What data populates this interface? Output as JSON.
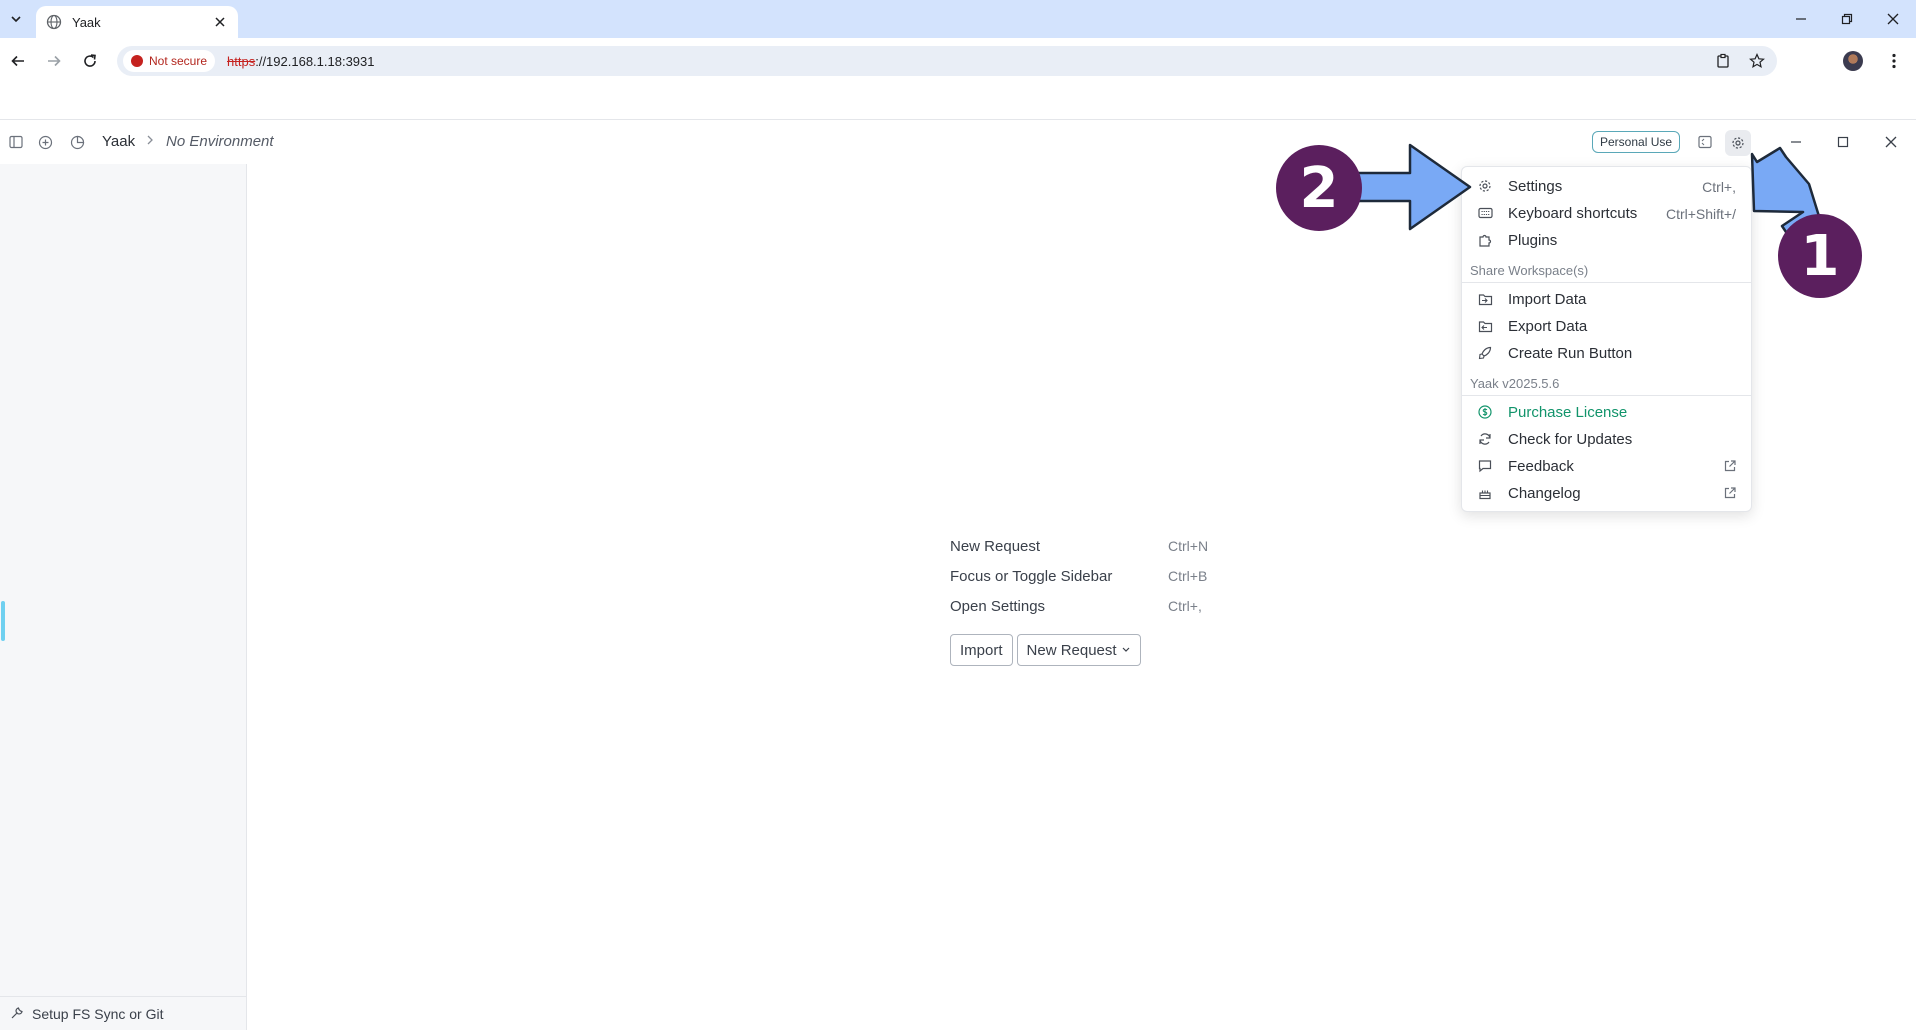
{
  "browser": {
    "tab_title": "Yaak",
    "security_label": "Not secure",
    "url_scheme": "https",
    "url_rest": "://192.168.1.18:3931"
  },
  "app": {
    "workspace": "Yaak",
    "environment": "No Environment",
    "license_badge": "Personal Use",
    "sidebar_footer": "Setup FS Sync or Git"
  },
  "empty_state": {
    "shortcuts": [
      {
        "label": "New Request",
        "key": "Ctrl+N"
      },
      {
        "label": "Focus or Toggle Sidebar",
        "key": "Ctrl+B"
      },
      {
        "label": "Open Settings",
        "key": "Ctrl+,"
      }
    ],
    "import_label": "Import",
    "new_request_label": "New Request"
  },
  "menu": {
    "settings": {
      "label": "Settings",
      "shortcut": "Ctrl+,",
      "icon": "gear-icon"
    },
    "keyboard": {
      "label": "Keyboard shortcuts",
      "shortcut": "Ctrl+Shift+/",
      "icon": "keyboard-icon"
    },
    "plugins": {
      "label": "Plugins",
      "icon": "puzzle-icon"
    },
    "section_share": "Share Workspace(s)",
    "import": {
      "label": "Import Data",
      "icon": "folder-input-icon"
    },
    "export": {
      "label": "Export Data",
      "icon": "folder-output-icon"
    },
    "run_button": {
      "label": "Create Run Button",
      "icon": "rocket-icon"
    },
    "section_version": "Yaak v2025.5.6",
    "purchase": {
      "label": "Purchase License",
      "icon": "dollar-circle-icon",
      "color": "#12946b"
    },
    "updates": {
      "label": "Check for Updates",
      "icon": "refresh-icon"
    },
    "feedback": {
      "label": "Feedback",
      "icon": "message-icon"
    },
    "changelog": {
      "label": "Changelog",
      "icon": "cake-icon"
    }
  },
  "callouts": {
    "one": "1",
    "two": "2",
    "color": "#5b1f5e",
    "arrow_color": "#79a9f5"
  }
}
